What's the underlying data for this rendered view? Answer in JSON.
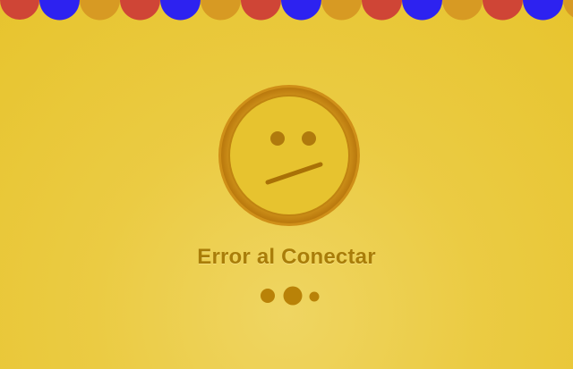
{
  "error": {
    "title": "Error al Conectar"
  },
  "colors": {
    "background": "#ebc93b",
    "accent_dark": "#a97d09",
    "bunting": [
      "#cf4536",
      "#2d22f0",
      "#d79a23"
    ]
  },
  "icons": {
    "face": "neutral-face-icon",
    "loader": "loading-dots-icon"
  }
}
